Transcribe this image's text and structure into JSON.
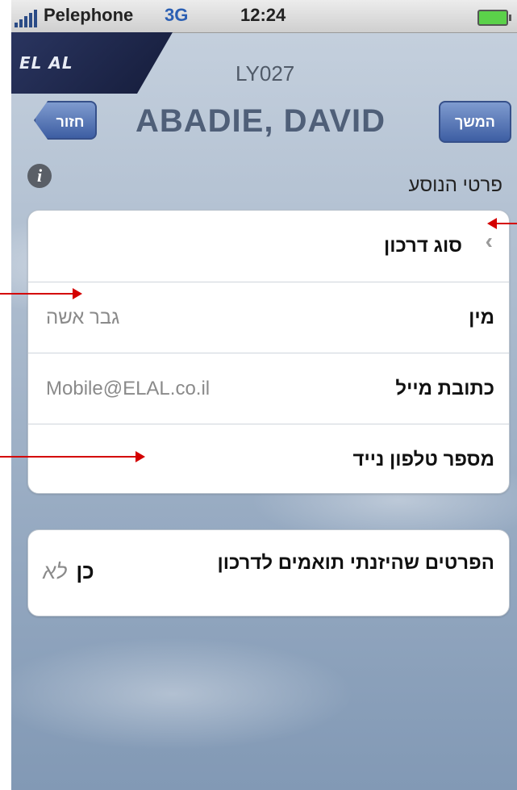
{
  "status_bar": {
    "carrier": "Pelephone",
    "network": "3G",
    "time": "12:24"
  },
  "header": {
    "logo_text": "EL AL",
    "flight_number": "LY027",
    "back_label": "חזור",
    "next_label": "המשך",
    "passenger_name": "ABADIE, DAVID"
  },
  "section": {
    "title": "פרטי הנוסע"
  },
  "fields": [
    {
      "label": "סוג דרכון",
      "value": ""
    },
    {
      "label": "מין",
      "value": "גבר אשה"
    },
    {
      "label": "כתובת מייל",
      "value": "Mobile@ELAL.co.il"
    },
    {
      "label": "מספר טלפון נייד",
      "value": ""
    }
  ],
  "confirmation": {
    "label": "הפרטים שהיזנתי תואמים לדרכון",
    "yes": "כן",
    "no": "לא"
  },
  "colors": {
    "button_blue": "#3d5ea3",
    "annotation_red": "#d40000"
  }
}
